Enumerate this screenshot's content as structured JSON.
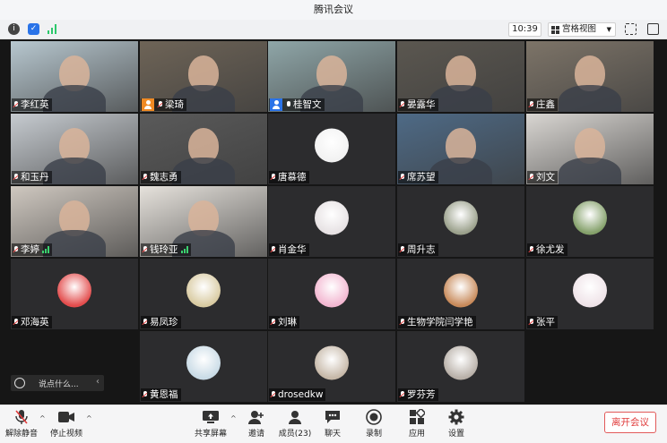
{
  "window": {
    "title": "腾讯会议"
  },
  "toolbar": {
    "info_icon": "info-icon",
    "shield_icon": "shield-icon",
    "signal_icon": "signal-icon",
    "time": "10:39",
    "view_mode": "宫格视图",
    "fullscreen_icon": "fullscreen-icon",
    "sidebar_icon": "sidebar-toggle-icon"
  },
  "participants": [
    {
      "name": "李红英",
      "mic": "muted",
      "video": true,
      "bg": "#b7c7cf"
    },
    {
      "name": "梁琦",
      "mic": "muted",
      "video": true,
      "host": "orange",
      "bg": "#6e6457"
    },
    {
      "name": "桂智文",
      "mic": "on",
      "video": true,
      "host": "blue",
      "active": true,
      "bg": "#8fa6a8"
    },
    {
      "name": "晏露华",
      "mic": "muted",
      "video": true,
      "bg": "#5b5750"
    },
    {
      "name": "庄鑫",
      "mic": "muted",
      "video": true,
      "bg": "#7d7468"
    },
    {
      "name": "和玉丹",
      "mic": "muted",
      "video": true,
      "bg": "#c6cbd0"
    },
    {
      "name": "魏志勇",
      "mic": "muted",
      "video": true,
      "bg": "#5a5a5a"
    },
    {
      "name": "唐慕德",
      "mic": "muted",
      "video": false,
      "avatar": "#f2f2f2"
    },
    {
      "name": "席苏望",
      "mic": "muted",
      "video": true,
      "bg": "#4e6a86"
    },
    {
      "name": "刘文",
      "mic": "muted",
      "video": true,
      "bg": "#d9d6d2"
    },
    {
      "name": "李婷",
      "mic": "muted",
      "video": true,
      "signal": true,
      "bg": "#cfc8c0"
    },
    {
      "name": "钱玲亚",
      "mic": "muted",
      "video": true,
      "signal": true,
      "bg": "#e6e2dc"
    },
    {
      "name": "肖金华",
      "mic": "muted",
      "video": false,
      "avatar": "#e7e2e4"
    },
    {
      "name": "周升志",
      "mic": "muted",
      "video": false,
      "avatar": "#9aa08b"
    },
    {
      "name": "徐尤发",
      "mic": "muted",
      "video": false,
      "avatar": "#84a06a"
    },
    {
      "name": "邓海英",
      "mic": "muted",
      "video": false,
      "avatar": "#e34c4c"
    },
    {
      "name": "易凤珍",
      "mic": "muted",
      "video": false,
      "avatar": "#d9cba2"
    },
    {
      "name": "刘琳",
      "mic": "muted",
      "video": false,
      "avatar": "#f3b7d1"
    },
    {
      "name": "生物学院闫学艳",
      "mic": "muted",
      "video": false,
      "avatar": "#c88a5a"
    },
    {
      "name": "张平",
      "mic": "muted",
      "video": false,
      "avatar": "#efe3e8"
    },
    {
      "name": "黄恩福",
      "mic": "muted",
      "video": false,
      "avatar": "#c9dbe6"
    },
    {
      "name": "drosedkw",
      "mic": "muted",
      "video": false,
      "avatar": "#c6b8a8"
    },
    {
      "name": "罗芬芳",
      "mic": "muted",
      "video": false,
      "avatar": "#b8b0a8"
    }
  ],
  "chat": {
    "placeholder": "说点什么...",
    "emoji_icon": "emoji-icon",
    "collapse_icon": "chevron-left-icon"
  },
  "bottom": {
    "unmute": "解除静音",
    "stop_video": "停止视频",
    "share_screen": "共享屏幕",
    "invite": "邀请",
    "members": "成员(23)",
    "chat": "聊天",
    "record": "录制",
    "apps": "应用",
    "settings": "设置",
    "leave": "离开会议"
  }
}
